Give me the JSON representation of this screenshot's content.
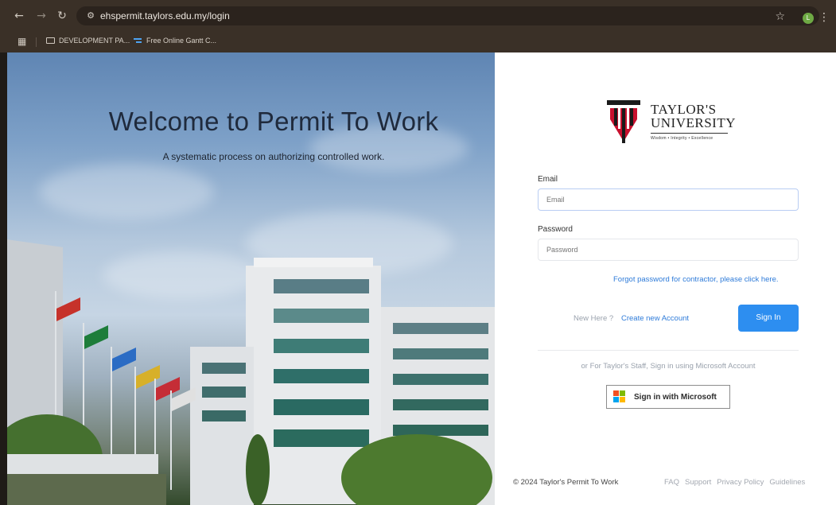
{
  "browser": {
    "url": "ehspermit.taylors.edu.my/login",
    "profile_initial": "L",
    "bookmarks": [
      {
        "label": "DEVELOPMENT PA...",
        "icon": "folder-icon"
      },
      {
        "label": "Free Online Gantt C...",
        "icon": "gantt-icon"
      }
    ]
  },
  "hero": {
    "title": "Welcome to Permit To Work",
    "subtitle": "A systematic process on authorizing controlled work."
  },
  "logo": {
    "line1": "TAYLOR'S",
    "line2": "UNIVERSITY",
    "tagline": "Wisdom • Integrity • Excellence",
    "colors": {
      "crest_red": "#c8102e",
      "crest_dark": "#1a1a1a"
    }
  },
  "form": {
    "email_label": "Email",
    "email_placeholder": "Email",
    "password_label": "Password",
    "password_placeholder": "Password",
    "forgot_link": "Forgot password for contractor, please click here.",
    "new_here": "New Here ?",
    "create_account": "Create new Account",
    "sign_in": "Sign In",
    "staff_note": "or For Taylor's Staff, Sign in using Microsoft Account",
    "microsoft_button": "Sign in with Microsoft"
  },
  "footer": {
    "copyright": "© 2024 Taylor's Permit To Work",
    "links": [
      "FAQ",
      "Support",
      "Privacy Policy",
      "Guidelines"
    ]
  },
  "colors": {
    "accent": "#2d8ef0",
    "link": "#2e7bd9",
    "muted": "#9aa2ad"
  }
}
